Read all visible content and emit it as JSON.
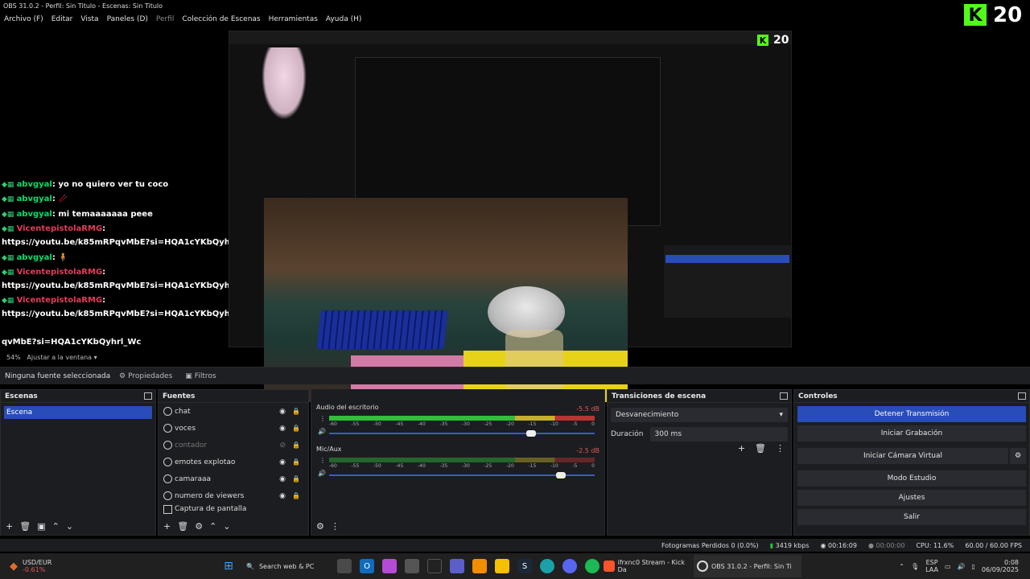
{
  "window": {
    "title": "OBS 31.0.2 - Perfil: Sin Titulo - Escenas: Sin Titulo"
  },
  "menu": [
    {
      "label": "Archivo (F)"
    },
    {
      "label": "Editar"
    },
    {
      "label": "Vista"
    },
    {
      "label": "Paneles (D)"
    },
    {
      "label": "Perfil"
    },
    {
      "label": "Colección de Escenas"
    },
    {
      "label": "Herramientas"
    },
    {
      "label": "Ayuda (H)"
    }
  ],
  "viewer_badge": {
    "count": "20"
  },
  "nested_badge": {
    "count": "20"
  },
  "chat": {
    "lines": [
      {
        "user": "abvgyal",
        "text": ": yo no quiero ver tu coco"
      },
      {
        "user": "abvgyal",
        "text": ": 🥢"
      },
      {
        "user": "abvgyal",
        "text": ": mi temaaaaaaa peee"
      },
      {
        "user": "VicentepistolaRMG",
        "text": ":"
      },
      {
        "link": "https://youtu.be/k85mRPqvMbE?si=HQA1cYKbQyhrl_Wc"
      },
      {
        "user": "abvgyal",
        "text": ": 🧍"
      },
      {
        "user": "VicentepistolaRMG",
        "text": ":"
      },
      {
        "link": "https://youtu.be/k85mRPqvMbE?si=HQA1cYKbQyhrl_Wc"
      },
      {
        "user": "VicentepistolaRMG",
        "text": ":"
      },
      {
        "link": "https://youtu.be/k85mRPqvMbE?si=HQA1cYKbQyhrl_Wc"
      },
      {
        "link": "qvMbE?si=HQA1cYKbQyhrl_Wc"
      }
    ]
  },
  "preview": {
    "zoom": "54%",
    "fit": "Ajustar a la ventana"
  },
  "source_bar": {
    "no_source": "Ninguna fuente seleccionada",
    "properties": "Propiedades",
    "filters": "Filtros"
  },
  "scenes": {
    "title": "Escenas",
    "items": [
      "Escena"
    ]
  },
  "sources": {
    "title": "Fuentes",
    "items": [
      {
        "name": "chat",
        "dim": false
      },
      {
        "name": "voces",
        "dim": false
      },
      {
        "name": "contador",
        "dim": true
      },
      {
        "name": "emotes explotao",
        "dim": false
      },
      {
        "name": "camaraaa",
        "dim": false
      },
      {
        "name": "numero de viewers",
        "dim": false
      },
      {
        "name": "Captura de pantalla",
        "dim": false
      }
    ]
  },
  "mixer": {
    "channels": [
      {
        "name": "Audio del escritorio",
        "db": "-5.5 dB",
        "level": 0.62,
        "volume": 0.76
      },
      {
        "name": "Mic/Aux",
        "db": "-2.5 dB",
        "level": 0.6,
        "volume": 0.87
      }
    ],
    "ticks": [
      "-60",
      "-55",
      "-50",
      "-45",
      "-40",
      "-35",
      "-30",
      "-25",
      "-20",
      "-15",
      "-10",
      "-5",
      "0"
    ]
  },
  "transitions": {
    "title": "Transiciones de escena",
    "type": "Desvanecimiento",
    "duration_label": "Duración",
    "duration": "300 ms"
  },
  "controls": {
    "title": "Controles",
    "buttons": [
      "Detener Transmisión",
      "Iniciar Grabación",
      "Iniciar Cámara Virtual",
      "Modo Estudio",
      "Ajustes",
      "Salir"
    ]
  },
  "status": {
    "frames_dropped": "Fotogramas Perdidos 0 (0.0%)",
    "bitrate": "3419 kbps",
    "stream_time": "00:16:09",
    "rec_time": "00:00:00",
    "cpu": "CPU: 11.6%",
    "fps": "60.00 / 60.00 FPS"
  },
  "taskbar": {
    "ticker_symbol": "USD/EUR",
    "ticker_change": "-0.61%",
    "search": "Search web & PC",
    "app1": "ifrxnc0 Stream - Kick Da",
    "app2": "OBS 31.0.2 - Perfil: Sin Ti",
    "lang1": "ESP",
    "lang2": "LAA",
    "time": "0:08",
    "date": "06/09/2025"
  }
}
